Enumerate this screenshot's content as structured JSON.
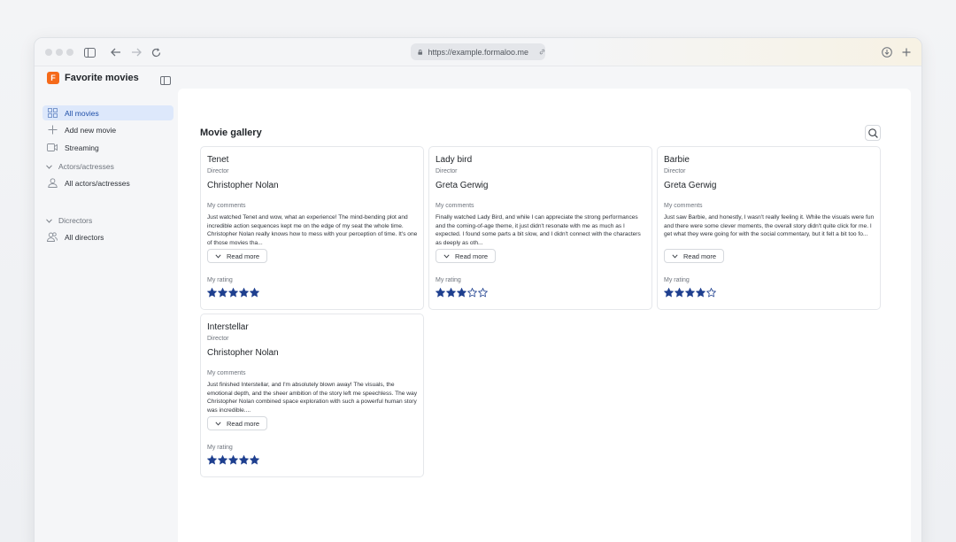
{
  "browser": {
    "url": "https://example.formaloo.me"
  },
  "sidebar": {
    "brand_letter": "F",
    "brand_title": "Favorite movies",
    "items": [
      {
        "label": "All movies",
        "icon": "grid-icon",
        "active": true
      },
      {
        "label": "Add new movie",
        "icon": "plus-icon",
        "active": false
      },
      {
        "label": "Streaming",
        "icon": "video-icon",
        "active": false
      }
    ],
    "sections": [
      {
        "label": "Actors/actresses",
        "items": [
          {
            "label": "All actors/actresses",
            "icon": "user-icon"
          }
        ]
      },
      {
        "label": "Dicrectors",
        "items": [
          {
            "label": "All directors",
            "icon": "users-icon"
          }
        ]
      }
    ]
  },
  "main": {
    "title": "Movie gallery",
    "cards": [
      {
        "title": "Tenet",
        "role_label": "Director",
        "person": "Christopher Nolan",
        "comments_label": "My comments",
        "comment": "Just watched Tenet and wow, what an experience! The mind-bending plot and incredible action sequences kept me on the edge of my seat the whole time. Christopher Nolan really knows how to mess with your perception of time. It's one of those movies tha...",
        "read_more": "Read more",
        "rating_label": "My rating",
        "rating": 5
      },
      {
        "title": "Lady bird",
        "role_label": "Director",
        "person": "Greta Gerwig",
        "comments_label": "My comments",
        "comment": "Finally watched Lady Bird, and while I can appreciate the strong performances and the coming-of-age theme, it just didn't resonate with me as much as I expected. I found some parts a bit slow, and I didn't connect with the characters as deeply as oth...",
        "read_more": "Read more",
        "rating_label": "My rating",
        "rating": 3
      },
      {
        "title": "Barbie",
        "role_label": "Director",
        "person": "Greta Gerwig",
        "comments_label": "My comments",
        "comment": "Just saw Barbie, and honestly, I wasn't really feeling it. While the visuals were fun and there were some clever moments, the overall story didn't quite click for me. I get what they were going for with the social commentary, but it felt a bit too fo...",
        "read_more": "Read more",
        "rating_label": "My rating",
        "rating": 4
      },
      {
        "title": "Interstellar",
        "role_label": "Director",
        "person": "Christopher Nolan",
        "comments_label": "My comments",
        "comment": "Just finished Interstellar, and I'm absolutely blown away! The visuals, the emotional depth, and the sheer ambition of the story left me speechless. The way Christopher Nolan combined space exploration with such a powerful human story was incredible....",
        "read_more": "Read more",
        "rating_label": "My rating",
        "rating": 5
      }
    ]
  },
  "colors": {
    "accent": "#f56a1a",
    "star": "#1e3f8f",
    "active_nav": "#dde8fb"
  }
}
